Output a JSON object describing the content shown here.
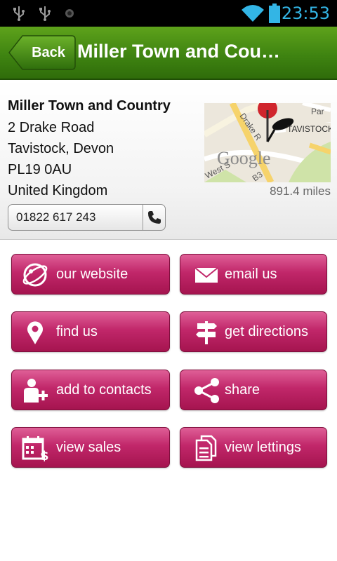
{
  "status_bar": {
    "time": "23:53",
    "icons": [
      "usb-icon",
      "usb-icon",
      "notification-icon",
      "wifi-icon",
      "battery-icon"
    ],
    "time_color": "#33b5e5"
  },
  "header": {
    "back_label": "Back",
    "title": "Miller Town and Country",
    "brand_color": "#3f8411"
  },
  "agent": {
    "name": "Miller Town and Country",
    "address_line1": "2 Drake Road",
    "address_line2": "Tavistock, Devon",
    "postcode": "PL19 0AU",
    "country": "United Kingdom",
    "phone": "01822 617 243",
    "distance": "891.4 miles"
  },
  "map": {
    "labels": [
      "Drake R",
      "Par",
      "TAVISTOCK",
      "West S",
      "B3"
    ],
    "logo": "Google"
  },
  "actions": {
    "accent_color": "#c1276a",
    "items": [
      {
        "label": "our website",
        "icon": "globe-icon"
      },
      {
        "label": "email us",
        "icon": "envelope-icon"
      },
      {
        "label": "find us",
        "icon": "map-pin-icon"
      },
      {
        "label": "get directions",
        "icon": "signpost-icon"
      },
      {
        "label": "add to contacts",
        "icon": "add-contact-icon"
      },
      {
        "label": "share",
        "icon": "share-icon"
      },
      {
        "label": "view sales",
        "icon": "calendar-money-icon"
      },
      {
        "label": "view lettings",
        "icon": "documents-icon"
      }
    ]
  }
}
